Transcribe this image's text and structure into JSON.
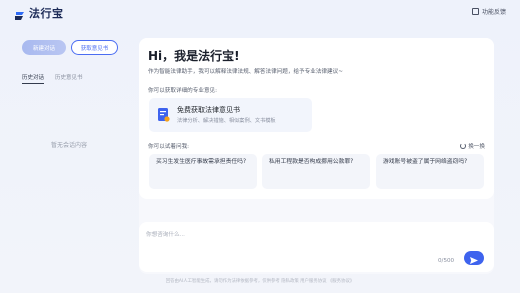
{
  "app": {
    "name": "法行宝",
    "feedback_label": "功能反馈"
  },
  "sidebar": {
    "new_chat_label": "新建对话",
    "get_opinion_label": "获取意见书",
    "tabs": [
      {
        "label": "历史对话",
        "active": true
      },
      {
        "label": "历史意见书",
        "active": false
      }
    ],
    "empty_text": "暂无会话内容"
  },
  "main": {
    "greeting": "Hi，我是法行宝!",
    "intro": "作为智能法律助手，我可以解释法律法规、解答法律问题，给予专业法律建议~",
    "get_label": "你可以获取详细的专业意见:",
    "free_card": {
      "title": "免费获取法律意见书",
      "subtitle": "法律分析、解决措施、相似案例、文书模板"
    },
    "ask_label": "你可以试着问我:",
    "refresh_label": "换一换",
    "questions": [
      "买习生发生医疗事故需承担责任吗?",
      "私用工程款是否构成挪用公款罪?",
      "游戏账号被盗了属于网络盗窃吗?"
    ]
  },
  "input": {
    "placeholder": "你想咨询什么...",
    "counter": "0/500"
  },
  "footer": "回答由AI人工智能生成，请勿作为法律依据参考，仅供参考   隐私政策   用户服务协议   《服务协议》",
  "colors": {
    "accent": "#3e63ee",
    "brand_dark": "#1b2a57"
  }
}
